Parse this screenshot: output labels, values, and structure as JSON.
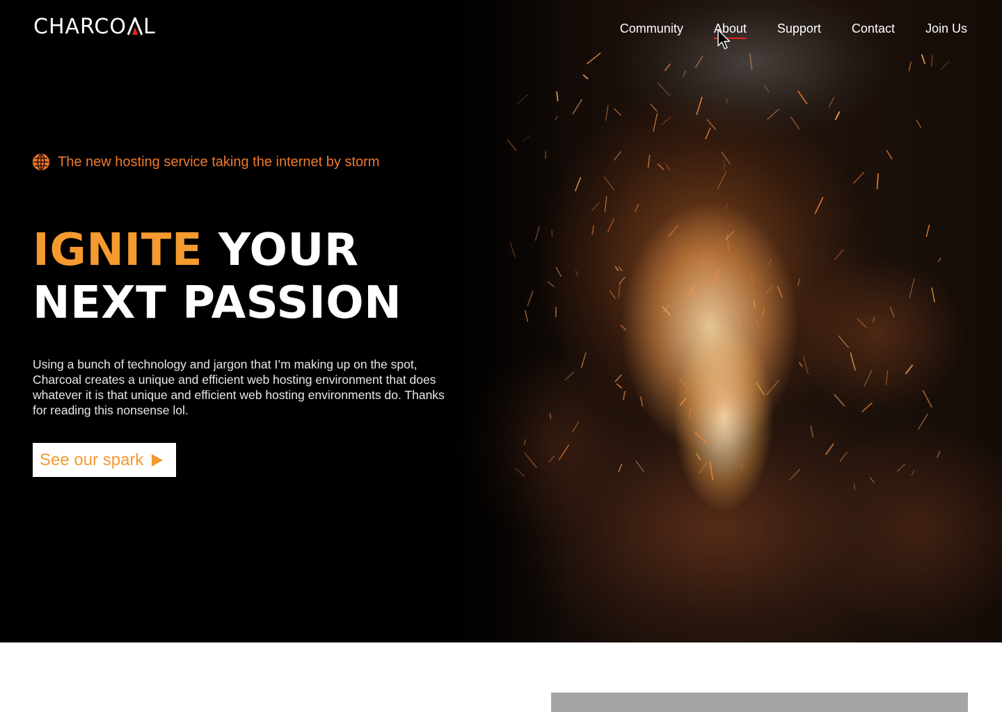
{
  "brand": {
    "name_prefix": "CHARCO",
    "name_suffix": "L",
    "accent_color": "#e8261e"
  },
  "nav": {
    "items": [
      {
        "label": "Community"
      },
      {
        "label": "About",
        "active": true
      },
      {
        "label": "Support"
      },
      {
        "label": "Contact"
      },
      {
        "label": "Join Us"
      }
    ]
  },
  "hero": {
    "tagline": "The new hosting service taking the internet by storm",
    "tagline_icon": "globe-icon",
    "headline_accent": "IGNITE",
    "headline_line1_rest": " YOUR",
    "headline_line2": "NEXT PASSION",
    "body": "Using a bunch of technology and jargon that I’m making up on the spot, Charcoal creates a unique and efficient web hosting environment that does whatever it is that unique and efficient web hosting environments do. Thanks for reading this nonsense lol.",
    "cta_label": "See our spark",
    "cta_icon": "play-triangle-icon"
  },
  "colors": {
    "orange": "#f49a2f",
    "tagline_orange": "#f07a2c",
    "nav_active_underline": "#e8261e",
    "hero_bg": "#000000",
    "placeholder_gray": "#a4a4a4"
  }
}
